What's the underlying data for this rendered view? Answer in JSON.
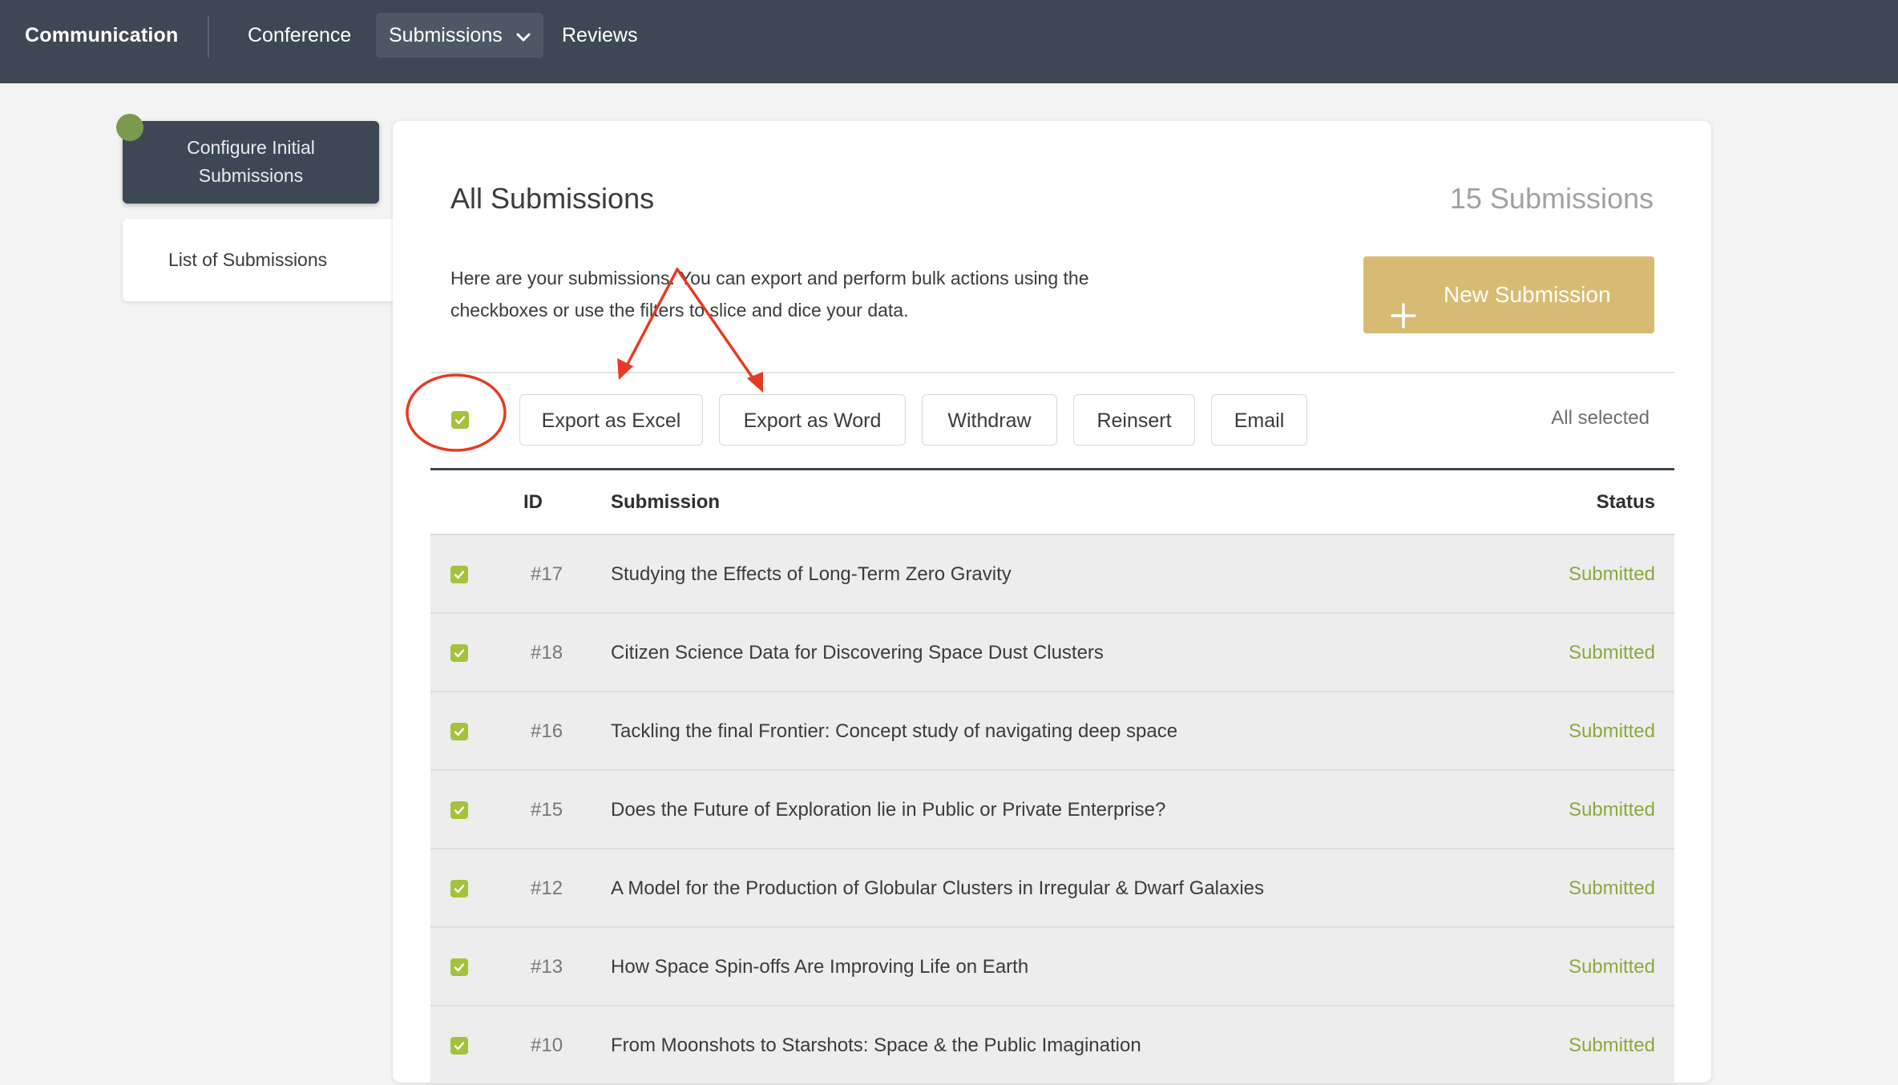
{
  "nav": {
    "brand": "Communication",
    "items": [
      {
        "label": "Conference"
      },
      {
        "label": "Submissions"
      },
      {
        "label": "Reviews"
      }
    ]
  },
  "sidebar": {
    "configure_label": "Configure Initial Submissions",
    "list_label": "List of Submissions"
  },
  "main": {
    "title": "All Submissions",
    "count": "15 Submissions",
    "description": "Here are your submissions. You can export and perform bulk actions using the checkboxes or use the filters to slice and dice your data.",
    "new_button": "New Submission"
  },
  "toolbar": {
    "buttons": [
      "Export as Excel",
      "Export as Word",
      "Withdraw",
      "Reinsert",
      "Email"
    ],
    "selection_text": "All selected"
  },
  "table": {
    "headers": {
      "id": "ID",
      "submission": "Submission",
      "status": "Status"
    },
    "rows": [
      {
        "id": "#17",
        "title": "Studying the Effects of Long-Term Zero Gravity",
        "status": "Submitted"
      },
      {
        "id": "#18",
        "title": "Citizen Science Data for Discovering Space Dust Clusters",
        "status": "Submitted"
      },
      {
        "id": "#16",
        "title": "Tackling the final Frontier: Concept study of navigating deep space",
        "status": "Submitted"
      },
      {
        "id": "#15",
        "title": "Does the Future of Exploration lie in Public or Private Enterprise?",
        "status": "Submitted"
      },
      {
        "id": "#12",
        "title": "A Model for the Production of Globular Clusters in Irregular & Dwarf Galaxies",
        "status": "Submitted"
      },
      {
        "id": "#13",
        "title": "How Space Spin-offs Are Improving Life on Earth",
        "status": "Submitted"
      },
      {
        "id": "#10",
        "title": "From Moonshots to Starshots: Space & the Public Imagination",
        "status": "Submitted"
      }
    ]
  },
  "colors": {
    "topbar": "#3e4854",
    "accent_gold": "#d8bb72",
    "checkbox_green": "#a4c23b",
    "status_green": "#8aa93f",
    "annotation_red": "#e53b24"
  }
}
